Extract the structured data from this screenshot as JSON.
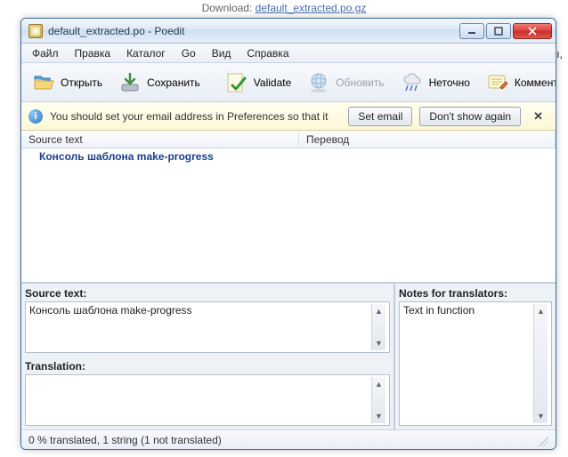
{
  "background": {
    "download_label": "Download:",
    "download_link": "default_extracted.po.gz",
    "fragment": "ы,"
  },
  "window": {
    "title": "default_extracted.po - Poedit"
  },
  "menu": {
    "file": "Файл",
    "edit": "Правка",
    "catalog": "Каталог",
    "go": "Go",
    "view": "Вид",
    "help": "Справка"
  },
  "toolbar": {
    "open": "Открыть",
    "save": "Сохранить",
    "validate": "Validate",
    "update": "Обновить",
    "fuzzy": "Неточно",
    "comment": "Коммент"
  },
  "infobar": {
    "message": "You should set your email address in Preferences so that it",
    "set_email": "Set email",
    "dont_show": "Don't show again"
  },
  "columns": {
    "source": "Source text",
    "translation": "Перевод"
  },
  "rows": [
    {
      "source": "Консоль шаблона make-progress",
      "translation": ""
    }
  ],
  "panes": {
    "source_label": "Source text:",
    "source_value": "Консоль шаблона make-progress",
    "translation_label": "Translation:",
    "translation_value": "",
    "notes_label": "Notes for translators:",
    "notes_value": "Text in function"
  },
  "status": {
    "text": "0 % translated, 1 string (1 not translated)"
  }
}
